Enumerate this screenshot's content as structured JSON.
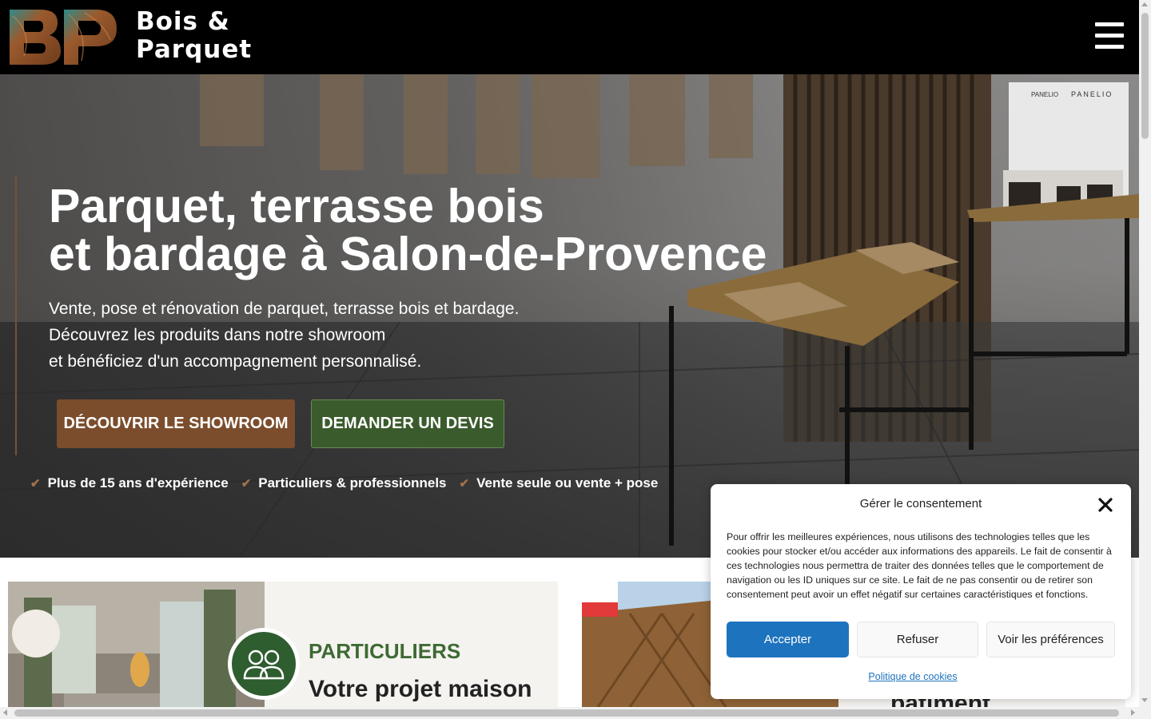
{
  "header": {
    "logo_text_line1": "Bois &",
    "logo_text_line2": "Parquet",
    "menu_icon": "hamburger-icon"
  },
  "hero": {
    "title_line1": "Parquet, terrasse bois",
    "title_line2": "et bardage à Salon-de-Provence",
    "desc_line1": "Vente, pose et rénovation de parquet, terrasse bois et bardage.",
    "desc_line2": "Découvrez les produits dans notre showroom",
    "desc_line3": "et bénéficiez d'un accompagnement personnalisé.",
    "btn_showroom": "DÉCOUVRIR LE SHOWROOM",
    "btn_devis": "DEMANDER UN DEVIS",
    "checks": [
      "Plus de 15 ans d'expérience",
      "Particuliers & professionnels",
      "Vente seule ou vente + pose"
    ],
    "panel_label_1": "PANELIO",
    "panel_label_2": "PANELIO"
  },
  "cards": {
    "card1_kicker": "PARTICULIERS",
    "card1_title": "Votre projet maison",
    "card2_title": "bâtiment"
  },
  "cookie": {
    "title": "Gérer le consentement",
    "text": "Pour offrir les meilleures expériences, nous utilisons des technologies telles que les cookies pour stocker et/ou accéder aux informations des appareils. Le fait de consentir à ces technologies nous permettra de traiter des données telles que le comportement de navigation ou les ID uniques sur ce site. Le fait de ne pas consentir ou de retirer son consentement peut avoir un effet négatif sur certaines caractéristiques et fonctions.",
    "accept": "Accepter",
    "refuse": "Refuser",
    "preferences": "Voir les préférences",
    "policy_link": "Politique de cookies"
  },
  "colors": {
    "brown": "#7b4d2c",
    "green": "#3a5b2c",
    "cookie_blue": "#1e73be"
  }
}
